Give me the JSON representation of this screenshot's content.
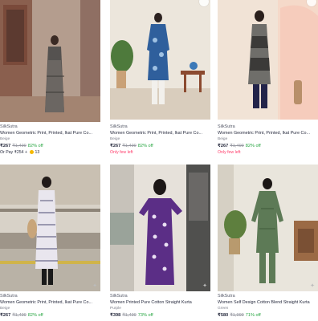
{
  "products": [
    {
      "brand": "SilkSutra",
      "title": "Women Geometric Print, Printed, Ikat Pure Co...",
      "color": "Beige",
      "price": "₹267",
      "mrp": "₹1,499",
      "discount": "82% off",
      "extra": "Or Pay ₹254 + ",
      "extra_coins": "13",
      "extra_type": "pay"
    },
    {
      "brand": "SilkSutra",
      "title": "Women Geometric Print, Printed, Ikat Pure Co...",
      "color": "Beige",
      "price": "₹267",
      "mrp": "₹1,499",
      "discount": "82% off",
      "extra": "Only few left",
      "extra_type": "stock"
    },
    {
      "brand": "SilkSutra",
      "title": "Women Geometric Print, Printed, Ikat Pure Co...",
      "color": "Beige",
      "price": "₹267",
      "mrp": "₹1,499",
      "discount": "82% off",
      "extra": "Only few left",
      "extra_type": "stock"
    },
    {
      "brand": "SilkSutra",
      "title": "Women Geometric Print, Printed, Ikat Pure Co...",
      "color": "Beige",
      "price": "₹267",
      "mrp": "₹1,499",
      "discount": "82% off"
    },
    {
      "brand": "SilkSutra",
      "title": "Women Printed Pure Cotton Straight Kurta",
      "color": "Purple",
      "price": "₹398",
      "mrp": "₹1,499",
      "discount": "73% off"
    },
    {
      "brand": "SilkSutra",
      "title": "Women Self Design Cotton Blend Straight Kurta",
      "color": "Green",
      "price": "₹580",
      "mrp": "₹1,999",
      "discount": "71% off"
    }
  ],
  "colors": {
    "discount": "#26a541",
    "stock_warning": "#ff3e6c",
    "coin": "#f5b800"
  },
  "icons": {
    "wishlist": "heart-icon",
    "more": "more-icon"
  }
}
